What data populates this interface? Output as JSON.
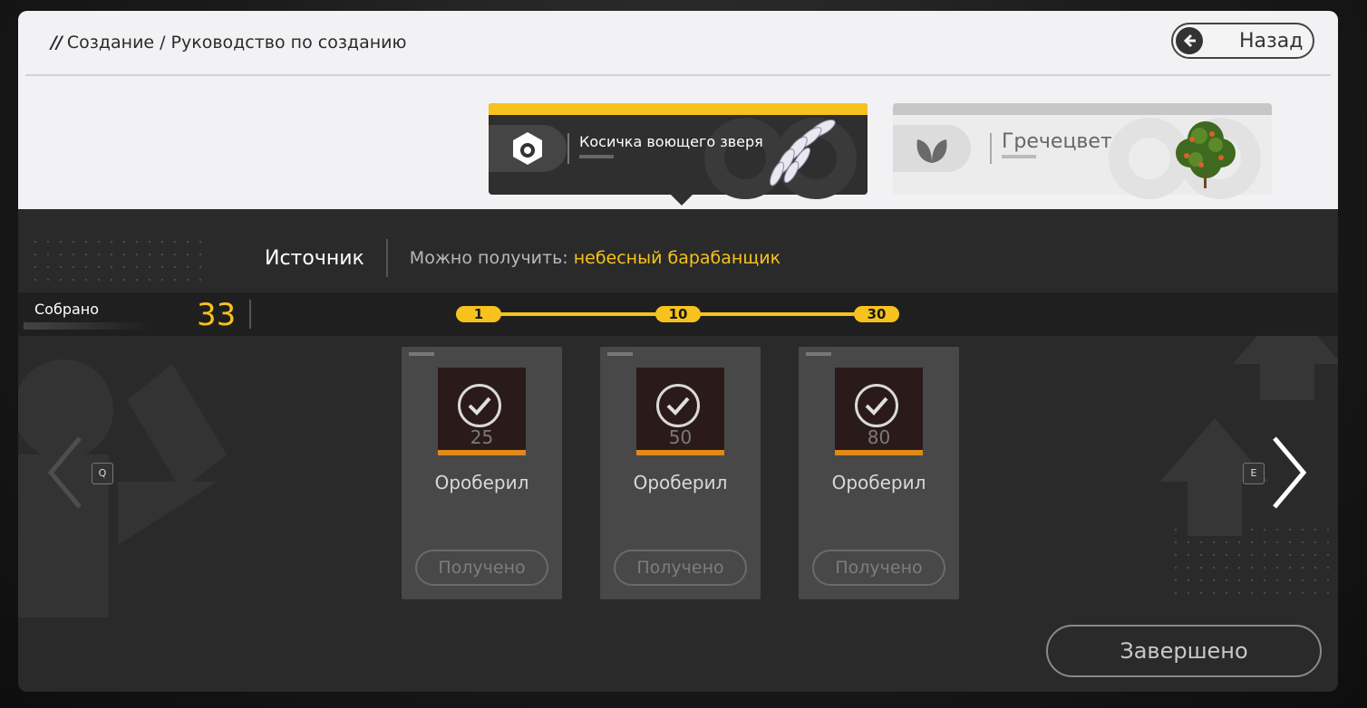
{
  "header": {
    "slashes": "//",
    "crumb_1": "Создание",
    "crumb_sep": "/",
    "crumb_2": "Руководство по созданию",
    "back_label": "Назад"
  },
  "cards": [
    {
      "title": "Косичка воющего зверя",
      "icon": "hexagon-ring-icon",
      "active": true
    },
    {
      "title": "Гречецвет",
      "icon": "leaf-icon",
      "active": false
    }
  ],
  "source": {
    "label": "Источник",
    "prefix": "Можно получить:",
    "value": "небесный барабанщик"
  },
  "collected": {
    "label": "Собрано",
    "count": "33"
  },
  "milestones": [
    "1",
    "10",
    "30"
  ],
  "rewards": [
    {
      "name": "Ороберил",
      "count": "25",
      "status": "Получено"
    },
    {
      "name": "Оробeрил",
      "count": "50",
      "status": "Получено"
    },
    {
      "name": "Ороберил",
      "count": "80",
      "status": "Получено"
    }
  ],
  "nav": {
    "prev_key": "Q",
    "next_key": "E"
  },
  "done_label": "Завершено",
  "colors": {
    "accent": "#f7c21d",
    "panel": "#2a2a2a",
    "top": "#f2f2f4"
  }
}
